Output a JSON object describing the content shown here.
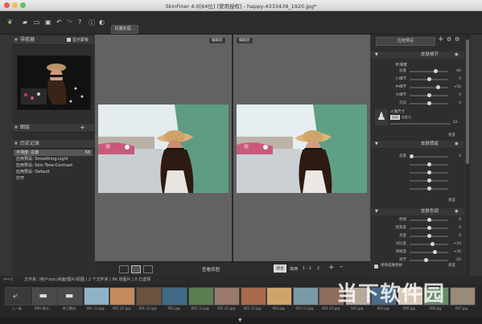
{
  "window": {
    "title": "SkinFiner 4.0[64位] [使用授权] - happy-4333439_1920.jpg*"
  },
  "toolbar": {
    "batch_label": "批量处理..."
  },
  "left": {
    "navigator_label": "导航器",
    "show_overlay_label": "显示蒙板",
    "layers_label": "图层",
    "history_label": "历史记录",
    "history": [
      {
        "label": "平滑度: 总量",
        "value": "68"
      },
      {
        "label": "应用预设: Smoothing-Light",
        "value": ""
      },
      {
        "label": "应用预设: Skin Tone-Contrast",
        "value": ""
      },
      {
        "label": "应用预设: Default",
        "value": ""
      },
      {
        "label": "打开",
        "value": ""
      }
    ]
  },
  "center": {
    "before_label": "编辑前",
    "after_label": "编辑后",
    "view_original": "查看原图",
    "fit_label": "适合",
    "fill_label": "填满",
    "zoom_ratio": "1 : 1",
    "zoom_value": "2"
  },
  "right": {
    "preset_select": "应用预设",
    "smoothing": {
      "title": "皮肤细节",
      "subtitle": "平滑度",
      "rows": [
        {
          "label": "总量",
          "value": "68",
          "level": 0.68
        },
        {
          "label": "小细节",
          "value": "0",
          "level": 0.5
        },
        {
          "label": "中细节",
          "value": "+50",
          "level": 0.75
        },
        {
          "label": "大细节",
          "value": "0",
          "level": 0.5
        },
        {
          "label": "方向",
          "value": "0",
          "level": 0.5
        }
      ],
      "person_size_label": "人像尺寸",
      "person_auto": "自动",
      "person_custom": "自定义",
      "person_value": "22",
      "reset": "重置"
    },
    "blemish": {
      "title": "皮肤瑕疵",
      "rows": [
        {
          "label": "总量",
          "value": "0",
          "level": 0.0
        },
        {
          "label": "",
          "value": "",
          "level": 0.5
        },
        {
          "label": "",
          "value": "",
          "level": 0.5
        },
        {
          "label": "",
          "value": "",
          "level": 0.5
        },
        {
          "label": "",
          "value": "",
          "level": 0.5
        }
      ],
      "reset": "重置"
    },
    "tone": {
      "title": "皮肤色调",
      "rows": [
        {
          "label": "色相",
          "value": "0",
          "level": 0.5
        },
        {
          "label": "饱和度",
          "value": "0",
          "level": 0.5
        },
        {
          "label": "亮度",
          "value": "0",
          "level": 0.5
        },
        {
          "label": "对比度",
          "value": "+20",
          "level": 0.6
        },
        {
          "label": "清晰度",
          "value": "+30",
          "level": 0.65
        },
        {
          "label": "调节",
          "value": "-20",
          "level": 0.4
        }
      ],
      "keep_label": "保持皮肤原始",
      "reset": "重置"
    }
  },
  "filebar": {
    "path": "文件夹: /用户/zyc/桌面/图片/原图 | 2 个文件夹 | 86 张图片 | 0 已选择"
  },
  "filmstrip": [
    {
      "cap": "上一级"
    },
    {
      "cap": "DNG 格式..."
    },
    {
      "cap": "练习素材"
    },
    {
      "cap": "001 (1).jpg"
    },
    {
      "cap": "001 (2).jpg"
    },
    {
      "cap": "001 (3).jpg"
    },
    {
      "cap": "001.jpg"
    },
    {
      "cap": "002 (1).jpg"
    },
    {
      "cap": "002 (2).jpg"
    },
    {
      "cap": "002 (3).jpg"
    },
    {
      "cap": "002.jpg"
    },
    {
      "cap": "003 (1).jpg"
    },
    {
      "cap": "003 (2).jpg"
    },
    {
      "cap": "003.jpg"
    },
    {
      "cap": "004.jpg"
    },
    {
      "cap": "005.jpg"
    },
    {
      "cap": "006.jpg"
    },
    {
      "cap": "007.jpg"
    }
  ],
  "watermark": {
    "text": "当下软件园"
  }
}
